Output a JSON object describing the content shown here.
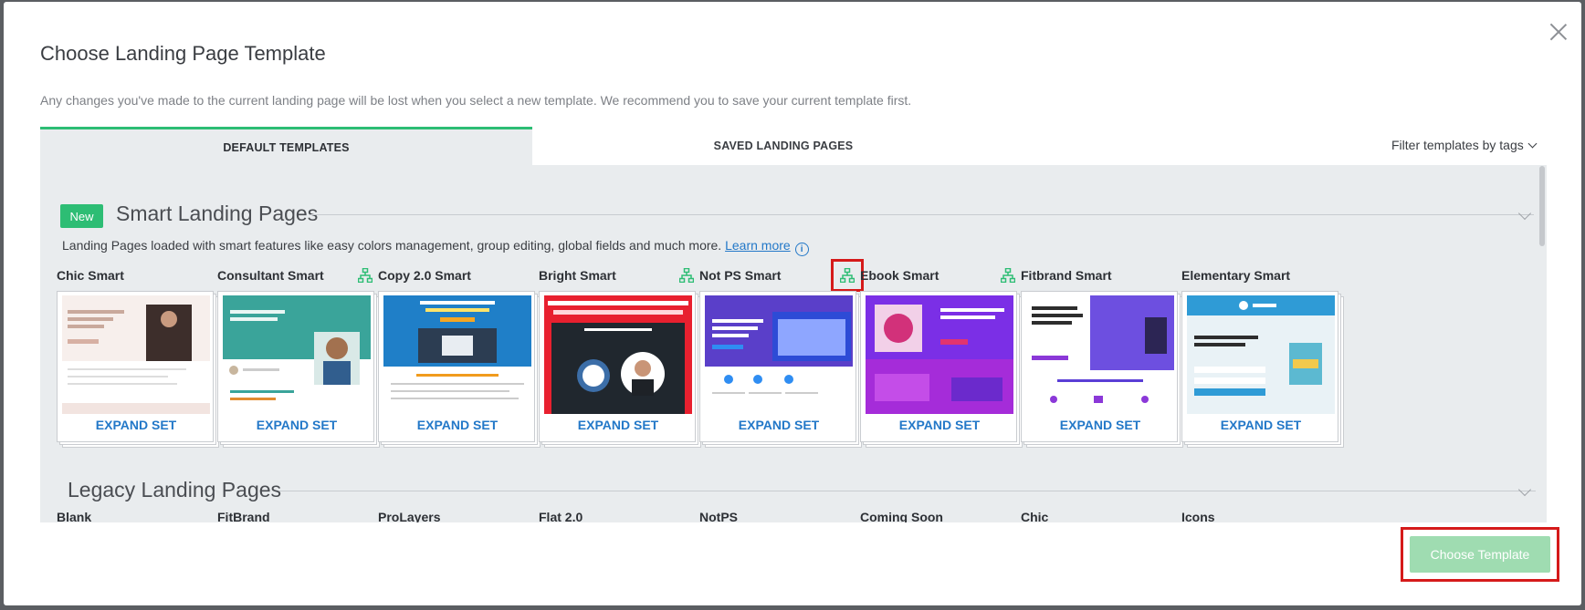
{
  "modal": {
    "title": "Choose Landing Page Template",
    "subtitle": "Any changes you've made to the current landing page will be lost when you select a new template. We recommend you to save your current template first."
  },
  "tabs": [
    {
      "label": "DEFAULT TEMPLATES",
      "active": true
    },
    {
      "label": "SAVED LANDING PAGES",
      "active": false
    }
  ],
  "filter": {
    "label": "Filter templates by tags"
  },
  "smart_section": {
    "badge": "New",
    "title": "Smart Landing Pages",
    "description": "Landing Pages loaded with smart features like easy colors management, group editing, global fields and much more.",
    "learn_more": "Learn more",
    "info_icon": "info-icon"
  },
  "templates": [
    {
      "name": "Chic Smart",
      "action": "EXPAND SET",
      "group_icon": false
    },
    {
      "name": "Consultant Smart",
      "action": "EXPAND SET",
      "group_icon": true
    },
    {
      "name": "Copy 2.0 Smart",
      "action": "EXPAND SET",
      "group_icon": false
    },
    {
      "name": "Bright Smart",
      "action": "EXPAND SET",
      "group_icon": true
    },
    {
      "name": "Not PS Smart",
      "action": "EXPAND SET",
      "group_icon": true,
      "highlighted": true
    },
    {
      "name": "Ebook Smart",
      "action": "EXPAND SET",
      "group_icon": true
    },
    {
      "name": "Fitbrand Smart",
      "action": "EXPAND SET",
      "group_icon": false
    },
    {
      "name": "Elementary Smart",
      "action": "EXPAND SET",
      "group_icon": false
    }
  ],
  "legacy_section": {
    "title": "Legacy Landing Pages",
    "items": [
      "Blank",
      "FitBrand",
      "ProLayers",
      "Flat 2.0",
      "NotPS",
      "Coming Soon",
      "Chic",
      "Icons"
    ]
  },
  "footer": {
    "choose_label": "Choose Template"
  },
  "colors": {
    "accent_green": "#2dbd74",
    "link_blue": "#2378c8",
    "highlight_red": "#d51a1a",
    "button_disabled": "#9fdcb1"
  }
}
